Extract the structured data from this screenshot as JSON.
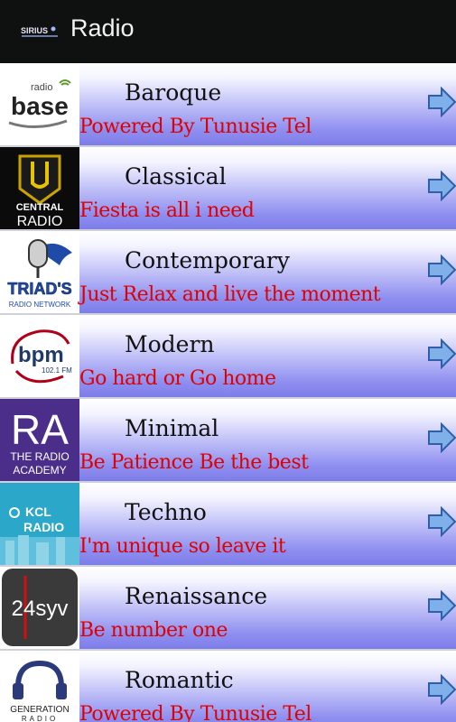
{
  "actionbar": {
    "title": "Radio",
    "logo_text": "SIRIUS"
  },
  "stations": [
    {
      "genre": "Baroque",
      "tagline": "Powered By Tunusie Tel",
      "logo_text": "radio base",
      "icon": "radio-base-logo"
    },
    {
      "genre": "Classical",
      "tagline": "Fiesta is all i need",
      "logo_text": "CENTRAL RADIO",
      "icon": "central-radio-logo"
    },
    {
      "genre": "Contemporary",
      "tagline": "Just Relax and live the moment",
      "logo_text": "TRIAD'S RADIO NETWORK",
      "icon": "triads-logo"
    },
    {
      "genre": "Modern",
      "tagline": "Go hard or Go home",
      "logo_text": "bpm 102.1 FM",
      "icon": "bpm-logo"
    },
    {
      "genre": "Minimal",
      "tagline": "Be Patience Be the best",
      "logo_text": "RA THE RADIO ACADEMY",
      "icon": "radio-academy-logo"
    },
    {
      "genre": "Techno",
      "tagline": "I'm unique so leave it",
      "logo_text": "KCL RADIO",
      "icon": "kcl-radio-logo"
    },
    {
      "genre": "Renaissance",
      "tagline": "Be number one",
      "logo_text": "24syv",
      "icon": "24syv-logo"
    },
    {
      "genre": "Romantic",
      "tagline": "Powered By Tunusie Tel",
      "logo_text": "GENERATION RADIO",
      "icon": "generation-radio-logo"
    }
  ]
}
